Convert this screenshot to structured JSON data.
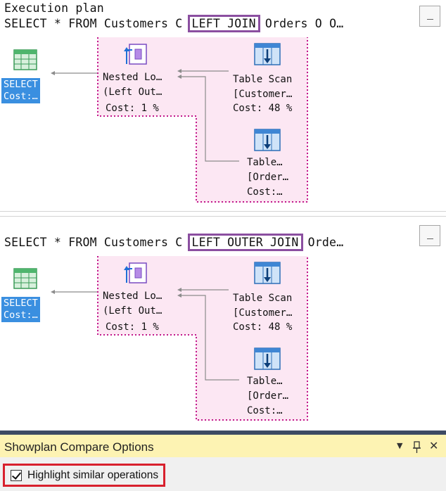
{
  "plan1": {
    "title": "Execution plan",
    "query_prefix": "SELECT * FROM Customers C",
    "query_highlight": "LEFT JOIN",
    "query_suffix": "Orders O O…"
  },
  "plan2": {
    "query_prefix": "SELECT * FROM Customers C",
    "query_highlight": "LEFT OUTER JOIN",
    "query_suffix": "Orde…"
  },
  "nodes": {
    "select": {
      "line1": "SELECT",
      "line2": "Cost:…"
    },
    "nested": {
      "line1": "Nested Lo…",
      "line2": "(Left Out…",
      "line3": "Cost: 1 %"
    },
    "scan_customers": {
      "line1": "Table Scan",
      "line2": "[Customer…",
      "line3": "Cost: 48 %"
    },
    "scan_orders": {
      "line1": "Table…",
      "line2": "[Order…",
      "line3": "Cost:…"
    }
  },
  "compare": {
    "title": "Showplan Compare Options",
    "dropdown_glyph": "▼",
    "pin_glyph": "📌",
    "close_glyph": "✕",
    "option_label": "Highlight similar operations",
    "option_checked": true
  },
  "colors": {
    "highlight_box": "#8b4fa0",
    "similar_zone": "#fce7f3",
    "similar_border": "#c2188b",
    "select_node": "#3a8fe0",
    "panel_header": "#fdf3b3",
    "option_outline": "#d8202d"
  },
  "icons": [
    "grid-icon",
    "nested-loops-icon",
    "table-scan-icon",
    "checkbox-icon",
    "pin-icon",
    "close-icon",
    "dropdown-arrow-icon",
    "collapse-icon"
  ]
}
